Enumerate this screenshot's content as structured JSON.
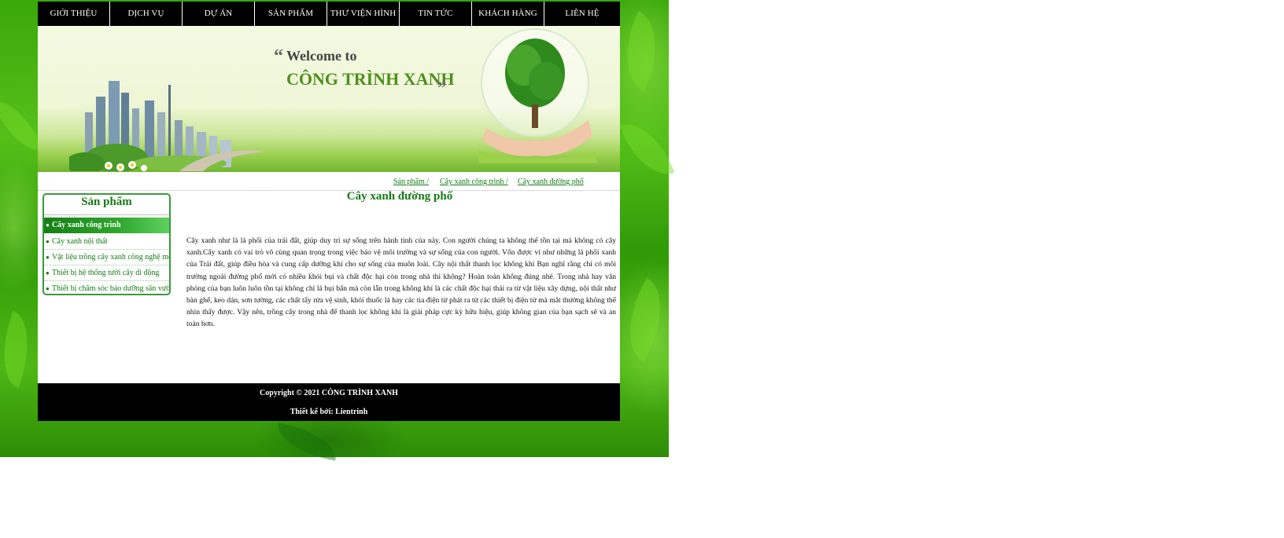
{
  "nav": {
    "items": [
      {
        "label": "GIỚI THIỆU"
      },
      {
        "label": "DỊCH VỤ"
      },
      {
        "label": "DỰ ÁN"
      },
      {
        "label": "SẢN PHẨM"
      },
      {
        "label": "THƯ VIỆN HÌNH"
      },
      {
        "label": "TIN TỨC"
      },
      {
        "label": "KHÁCH HÀNG"
      },
      {
        "label": "LIÊN HỆ"
      }
    ]
  },
  "banner": {
    "welcome": "Welcome to",
    "brand": "CÔNG TRÌNH XANH"
  },
  "breadcrumb": {
    "items": [
      "Sản phẩm /",
      "Cây xanh công trình /",
      "Cây xanh đường phố"
    ]
  },
  "sidebar": {
    "title": "Sản phẩm",
    "items": [
      {
        "label": "Cây xanh công trình",
        "active": true
      },
      {
        "label": "Cây xanh nội thất"
      },
      {
        "label": "Vật liệu trồng cây xanh công nghệ mới"
      },
      {
        "label": "Thiết bị hệ thống tưới cây di động"
      },
      {
        "label": "Thiết bị chăm sóc bảo dưỡng sân vườn"
      }
    ]
  },
  "main": {
    "title": "Cây xanh đường phố",
    "body": "Cây xanh như là lá phổi của trái đất, giúp duy trì sự sống trên hành tinh của này. Con người chúng ta không thể tồn tại mà không có cây xanh.Cây xanh có vai trò vô cùng quan trọng trong việc bảo vệ môi trường và sự sống của con người. Vốn được ví như những lá phổi xanh của Trái đất, giúp điều hòa và cung cấp dưỡng khí cho sự sống của muôn loài. Cây nội thất thanh lọc không khí Bạn nghĩ rằng chỉ có môi trường ngoài đường phố mới có nhiều khói bụi và chất độc hại còn trong nhà thì không? Hoàn toàn không đúng nhé. Trong nhà hay văn phòng của bạn luôn luôn tồn tại không chỉ là bụi bẩn mà còn lẫn trong không khí là các chất độc hại thải ra từ vật liệu xây dựng, nội thất như bàn ghế, keo dán, sơn tường, các chất tẩy rửa vệ sinh, khói thuốc lá hay các tia điện từ phát ra từ các thiết bị điện tử mà mắt thường không thể nhìn thấy được. Vậy nên, trồng cây trong nhà để thanh lọc không khí là giải pháp cực kỳ hữu hiệu, giúp không gian của bạn sạch sẽ và an toàn hơn."
  },
  "footer": {
    "copyright": "Copyright © 2021 CÔNG TRÌNH XANH",
    "designer": "Thiết kế bởi: Lientrinh"
  },
  "colors": {
    "accent": "#137a13",
    "nav_bg": "#000000",
    "page_bg_green": "#3aa70a"
  }
}
